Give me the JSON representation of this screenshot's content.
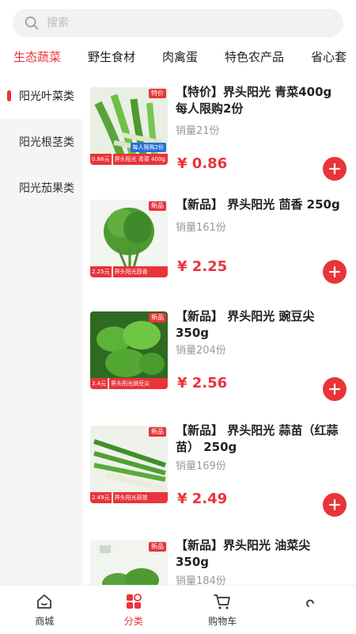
{
  "search": {
    "placeholder": "搜索"
  },
  "top_tabs": [
    "生态蔬菜",
    "野生食材",
    "肉禽蛋",
    "特色农产品",
    "省心套"
  ],
  "sidebar": {
    "items": [
      "阳光叶菜类",
      "阳光根茎类",
      "阳光茄果类"
    ]
  },
  "products": [
    {
      "title": "【特价】界头阳光 青菜400g 每人限购2份",
      "sales": "销量21份",
      "price": "¥ 0.86",
      "tag": "特价",
      "strip_price": "0.86元",
      "strip_name": "界头阳光 青菜 400g",
      "promo": "每人限购2份"
    },
    {
      "title": "【新品】 界头阳光 茴香 250g",
      "sales": "销量161份",
      "price": "¥ 2.25",
      "tag": "新品",
      "strip_price": "2.25元",
      "strip_name": "界头阳光茴香"
    },
    {
      "title": "【新品】 界头阳光 豌豆尖 350g",
      "sales": "销量204份",
      "price": "¥ 2.56",
      "tag": "新品",
      "strip_price": "3.4元",
      "strip_name": "界头阳光豌豆尖"
    },
    {
      "title": "【新品】 界头阳光 蒜苗（红蒜苗） 250g",
      "sales": "销量169份",
      "price": "¥ 2.49",
      "tag": "新品",
      "strip_price": "2.49元",
      "strip_name": "界头阳光蒜苗"
    },
    {
      "title": "【新品】界头阳光 油菜尖 350g",
      "sales": "销量184份",
      "tag": "新品"
    }
  ],
  "bottom_nav": [
    {
      "label": "商城",
      "icon": "home-icon"
    },
    {
      "label": "分类",
      "icon": "category-icon"
    },
    {
      "label": "购物车",
      "icon": "cart-icon"
    },
    {
      "label": "",
      "icon": "user-icon"
    }
  ],
  "colors": {
    "accent": "#e8343a",
    "sidebar_bg": "#f5f5f5"
  }
}
